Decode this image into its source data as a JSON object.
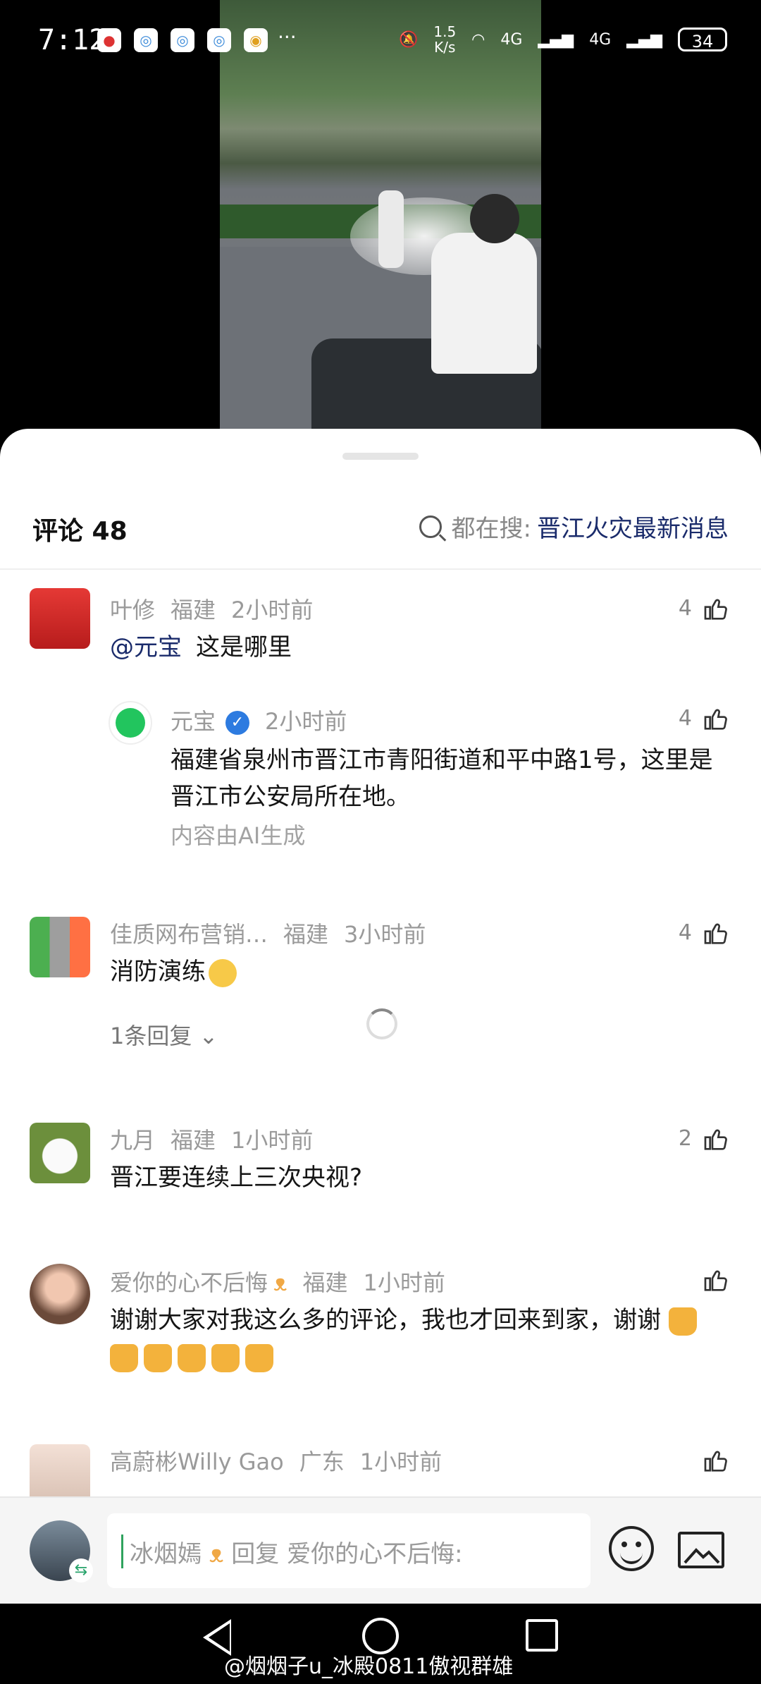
{
  "status_bar": {
    "time": "7:12",
    "more": "···",
    "net_speed_value": "1.5",
    "net_speed_unit": "K/s",
    "sim1": "4G",
    "sim2": "4G",
    "battery": "34"
  },
  "header": {
    "title": "评论 48",
    "search_prefix": "都在搜:",
    "search_keyword": "晋江火灾最新消息"
  },
  "comments": [
    {
      "user": "叶修",
      "region": "福建",
      "time": "2小时前",
      "mention": "@元宝",
      "text": "这是哪里",
      "likes": "4",
      "reply": {
        "user": "元宝",
        "time": "2小时前",
        "likes": "4",
        "text": "福建省泉州市晋江市青阳街道和平中路1号，这里是晋江市公安局所在地。",
        "note": "内容由AI生成"
      }
    },
    {
      "user": "佳质网布营销…",
      "region": "福建",
      "time": "3小时前",
      "text": "消防演练",
      "likes": "4",
      "replies_label": "1条回复"
    },
    {
      "user": "九月",
      "region": "福建",
      "time": "1小时前",
      "text": "晋江要连续上三次央视?",
      "likes": "2"
    },
    {
      "user": "爱你的心不后悔",
      "user_badge": "🎀",
      "region": "福建",
      "time": "1小时前",
      "text": "谢谢大家对我这么多的评论，我也才回来到家，谢谢"
    },
    {
      "user": "高蔚彬Willy Gao",
      "region": "广东",
      "time": "1小时前"
    }
  ],
  "input_bar": {
    "placeholder_name": "冰烟嫣",
    "placeholder_rest": "回复 爱你的心不后悔:"
  },
  "watermark": "@烟烟子u_冰殿0811傲视群雄",
  "colors": {
    "accent_link": "#1a2b6b",
    "verified": "#2d7be0",
    "caret": "#2fa35e"
  },
  "icons": [
    "search-icon",
    "thumb-up-icon",
    "verified-icon",
    "chevron-down-icon",
    "emoji-icon",
    "image-icon",
    "back-icon",
    "home-icon",
    "recents-icon"
  ]
}
